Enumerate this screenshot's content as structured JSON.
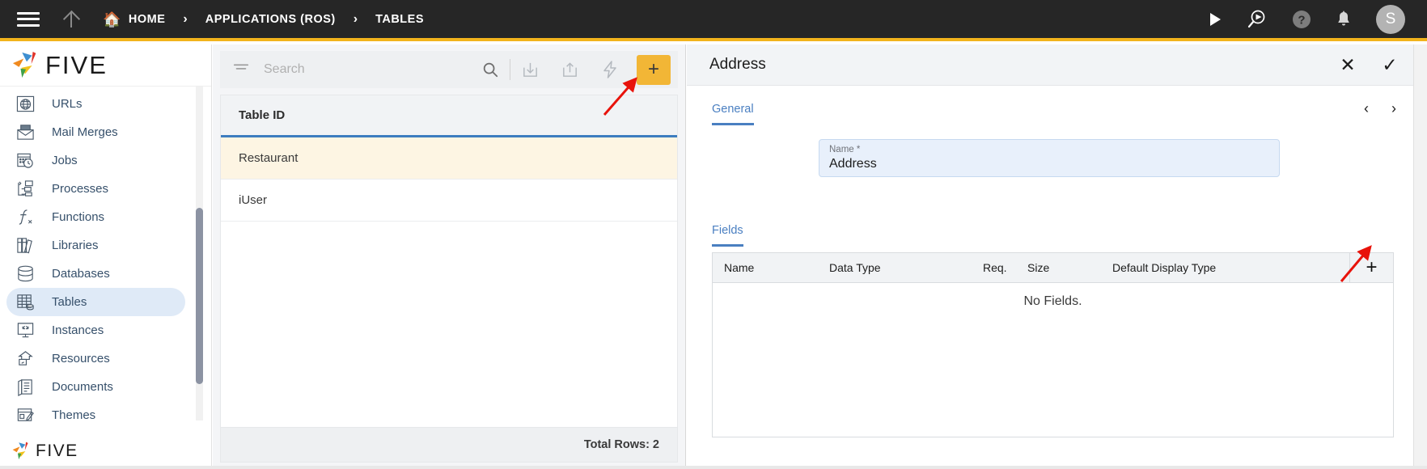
{
  "topbar": {
    "menu_icon": "hamburger-icon",
    "up_icon": "arrow-up-icon",
    "breadcrumbs": [
      {
        "label": "HOME",
        "icon": "home-icon"
      },
      {
        "label": "APPLICATIONS (ROS)",
        "icon": ""
      },
      {
        "label": "TABLES",
        "icon": ""
      }
    ],
    "separator": "›",
    "actions": [
      {
        "name": "run-icon",
        "glyph": "▶"
      },
      {
        "name": "debug-run-icon",
        "glyph": ""
      },
      {
        "name": "help-icon",
        "glyph": "?"
      },
      {
        "name": "notifications-bell-icon",
        "glyph": ""
      }
    ],
    "avatar_initial": "S"
  },
  "sidebar": {
    "logo_text": "FIVE",
    "footer_logo_text": "FIVE",
    "items": [
      {
        "label": "URLs",
        "icon": "globe-icon",
        "active": false
      },
      {
        "label": "Mail Merges",
        "icon": "mail-merge-icon",
        "active": false
      },
      {
        "label": "Jobs",
        "icon": "calendar-clock-icon",
        "active": false
      },
      {
        "label": "Processes",
        "icon": "flowchart-icon",
        "active": false
      },
      {
        "label": "Functions",
        "icon": "function-icon",
        "active": false
      },
      {
        "label": "Libraries",
        "icon": "books-icon",
        "active": false
      },
      {
        "label": "Databases",
        "icon": "database-icon",
        "active": false
      },
      {
        "label": "Tables",
        "icon": "table-grid-icon",
        "active": true
      },
      {
        "label": "Instances",
        "icon": "monitor-expand-icon",
        "active": false
      },
      {
        "label": "Resources",
        "icon": "resources-icon",
        "active": false
      },
      {
        "label": "Documents",
        "icon": "documents-icon",
        "active": false
      },
      {
        "label": "Themes",
        "icon": "theme-palette-icon",
        "active": false
      }
    ]
  },
  "list_panel": {
    "search": {
      "placeholder": "Search",
      "value": ""
    },
    "toolbar": [
      {
        "name": "filter-icon"
      },
      {
        "name": "search-icon"
      },
      {
        "name": "import-icon"
      },
      {
        "name": "export-icon"
      },
      {
        "name": "lightning-bolt-icon"
      }
    ],
    "add_button_label": "+",
    "add_button_color": "#F2B636",
    "column_header": "Table ID",
    "rows": [
      {
        "table_id": "Restaurant",
        "selected": true
      },
      {
        "table_id": "iUser",
        "selected": false
      }
    ],
    "footer_text": "Total Rows: 2",
    "selected_row_color": "#FDF5E3",
    "header_underline_color": "#3D7DBF"
  },
  "detail_panel": {
    "title": "Address",
    "close_label": "✕",
    "confirm_label": "✓",
    "prev_label": "‹",
    "next_label": "›",
    "tab_general": "General",
    "name_field": {
      "label": "Name *",
      "value": "Address"
    },
    "tab_fields": "Fields",
    "fields_table": {
      "columns": [
        "Name",
        "Data Type",
        "Req.",
        "Size",
        "Default Display Type"
      ],
      "add_label": "+",
      "empty_text": "No Fields.",
      "rows": []
    },
    "accent_color": "#4A7FC1"
  },
  "annotations": {
    "arrow_color": "#E8130B",
    "arrow_targets": [
      "lightning-bolt-icon",
      "fields-add-button"
    ]
  }
}
